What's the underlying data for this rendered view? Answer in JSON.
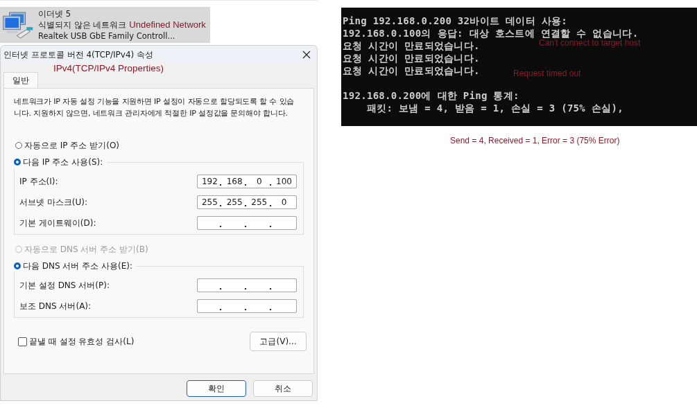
{
  "adapter": {
    "name": "이더넷 5",
    "status": "식별되지 않은 네트워크",
    "device": "Realtek USB GbE Family Controll...",
    "selected": true
  },
  "adapter_note": "Undefined Network",
  "dialog": {
    "title": "인터넷 프로토콜 버전 4(TCP/IPv4) 속성",
    "title_note": "IPv4(TCP/IPv4 Properties)",
    "tabs": [
      {
        "label": "일반",
        "selected": true
      }
    ],
    "description": "네트워크가 IP 자동 설정 기능을 지원하면 IP 설정이 자동으로 할당되도록 할 수 있습니다. 지원하지 않으면, 네트워크 관리자에게 적절한 IP 설정값을 문의해야 합니다.",
    "groups": [
      {
        "auto": {
          "label": "자동으로 IP 주소 받기(O)",
          "selected": false,
          "disabled": false
        },
        "manual": {
          "label": "다음 IP 주소 사용(S):",
          "selected": true,
          "disabled": false
        },
        "fields": [
          {
            "label": "IP 주소(I):",
            "octets": [
              "192",
              "168",
              "0",
              "100"
            ]
          },
          {
            "label": "서브넷 마스크(U):",
            "octets": [
              "255",
              "255",
              "255",
              "0"
            ]
          },
          {
            "label": "기본 게이트웨이(D):"
          }
        ]
      },
      {
        "auto": {
          "label": "자동으로 DNS 서버 주소 받기(B)",
          "selected": false,
          "disabled": true
        },
        "manual": {
          "label": "다음 DNS 서버 주소 사용(E):",
          "selected": true,
          "disabled": false
        },
        "fields": [
          {
            "label": "기본 설정 DNS 서버(P):"
          },
          {
            "label": "보조 DNS 서버(A):"
          }
        ]
      }
    ],
    "validate": {
      "label": "끝낼 때 설정 유효성 검사(L)",
      "checked": false
    },
    "advanced_button": "고급(V)...",
    "buttons": [
      {
        "label": "확인",
        "kind": "default"
      },
      {
        "label": "취소",
        "kind": "normal"
      }
    ]
  },
  "console": {
    "blocks": [
      [
        "Ping 192.168.0.200 32바이트 데이터 사용:",
        "192.168.0.100의 응답: 대상 호스트에 연결할 수 없습니다.",
        "요청 시간이 만료되었습니다.",
        "요청 시간이 만료되었습니다.",
        "요청 시간이 만료되었습니다."
      ],
      [
        "192.168.0.200에 대한 Ping 통계:",
        "    패킷: 보냄 = 4, 받음 = 1, 손실 = 3 (75% 손실),"
      ]
    ],
    "notes": [
      "Can't connect to target host",
      "Request timed out"
    ]
  },
  "summary_note": "Send = 4, Received = 1, Error = 3 (75% Error)"
}
